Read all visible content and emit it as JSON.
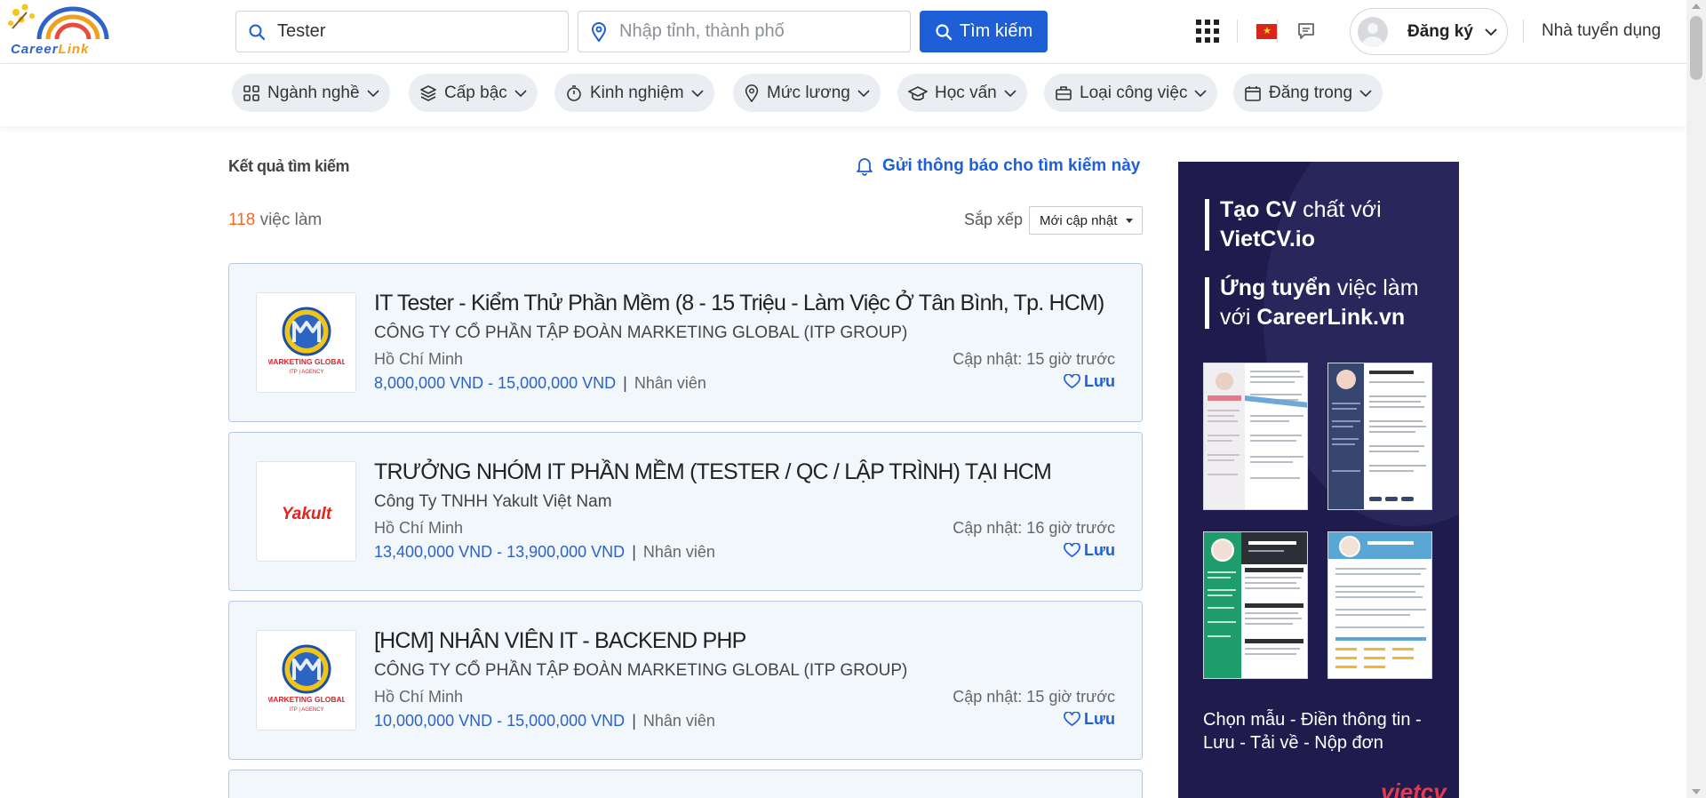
{
  "brand": {
    "logo_text_a": "Career",
    "logo_text_b": "Link"
  },
  "header": {
    "search": {
      "keyword_value": "Tester",
      "location_placeholder": "Nhập tỉnh, thành phố",
      "button_label": "Tìm kiếm"
    },
    "register_label": "Đăng ký",
    "employer_label": "Nhà tuyển dụng",
    "flag_star": "★"
  },
  "filters": [
    {
      "label": "Ngành nghề",
      "icon": "category-grid-icon"
    },
    {
      "label": "Cấp bậc",
      "icon": "layers-icon"
    },
    {
      "label": "Kinh nghiệm",
      "icon": "stopwatch-icon"
    },
    {
      "label": "Mức lương",
      "icon": "map-pin-icon"
    },
    {
      "label": "Học vấn",
      "icon": "graduation-cap-icon"
    },
    {
      "label": "Loại công việc",
      "icon": "briefcase-icon"
    },
    {
      "label": "Đăng trong",
      "icon": "calendar-icon"
    }
  ],
  "results": {
    "heading": "Kết quả tìm kiếm",
    "alert_link": "Gửi thông báo cho tìm kiếm này",
    "count_number": "118",
    "count_suffix": " việc làm",
    "sort_label": "Sắp xếp",
    "sort_value": "Mới cập nhật"
  },
  "jobs": [
    {
      "title": "IT Tester - Kiểm Thử Phần Mềm (8 - 15 Triệu - Làm Việc Ở Tân Bình, Tp. HCM)",
      "company": "CÔNG TY CỔ PHẦN TẬP ĐOÀN MARKETING GLOBAL (ITP GROUP)",
      "location": "Hồ Chí Minh",
      "salary": "8,000,000 VND - 15,000,000 VND",
      "separator": "|",
      "level": "Nhân viên",
      "updated": "Cập nhật: 15 giờ trước",
      "save_label": "Lưu",
      "logo": {
        "type": "marketing-global",
        "line1": "MARKETING GLOBAL",
        "line2": "ITP | AGENCY"
      }
    },
    {
      "title": "TRƯỞNG NHÓM IT PHẦN MỀM (TESTER / QC / LẬP TRÌNH) TẠI HCM",
      "company": "Công Ty TNHH Yakult Việt Nam",
      "location": "Hồ Chí Minh",
      "salary": "13,400,000 VND - 13,900,000 VND",
      "separator": "|",
      "level": "Nhân viên",
      "updated": "Cập nhật: 16 giờ trước",
      "save_label": "Lưu",
      "logo": {
        "type": "yakult",
        "line1": "Yakult"
      }
    },
    {
      "title": "[HCM] NHÂN VIÊN IT - BACKEND PHP",
      "company": "CÔNG TY CỔ PHẦN TẬP ĐOÀN MARKETING GLOBAL (ITP GROUP)",
      "location": "Hồ Chí Minh",
      "salary": "10,000,000 VND - 15,000,000 VND",
      "separator": "|",
      "level": "Nhân viên",
      "updated": "Cập nhật: 15 giờ trước",
      "save_label": "Lưu",
      "logo": {
        "type": "marketing-global",
        "line1": "MARKETING GLOBAL",
        "line2": "ITP | AGENCY"
      }
    }
  ],
  "ad": {
    "line1_bold": "Tạo CV",
    "line1_rest": " chất với",
    "line1_site": "VietCV.io",
    "line2_bold": "Ứng tuyển",
    "line2_rest": " việc làm",
    "line2_prefix": "với ",
    "line2_site": "CareerLink.vn",
    "caption": "Chọn mẫu - Điền thông tin - Lưu - Tải về - Nộp đơn",
    "brand": "vietcv"
  },
  "colors": {
    "primary": "#1e5fd8",
    "accent_orange": "#f26b2b",
    "card_bg": "#f2f7fc",
    "ad_bg": "#1f1c4d"
  }
}
